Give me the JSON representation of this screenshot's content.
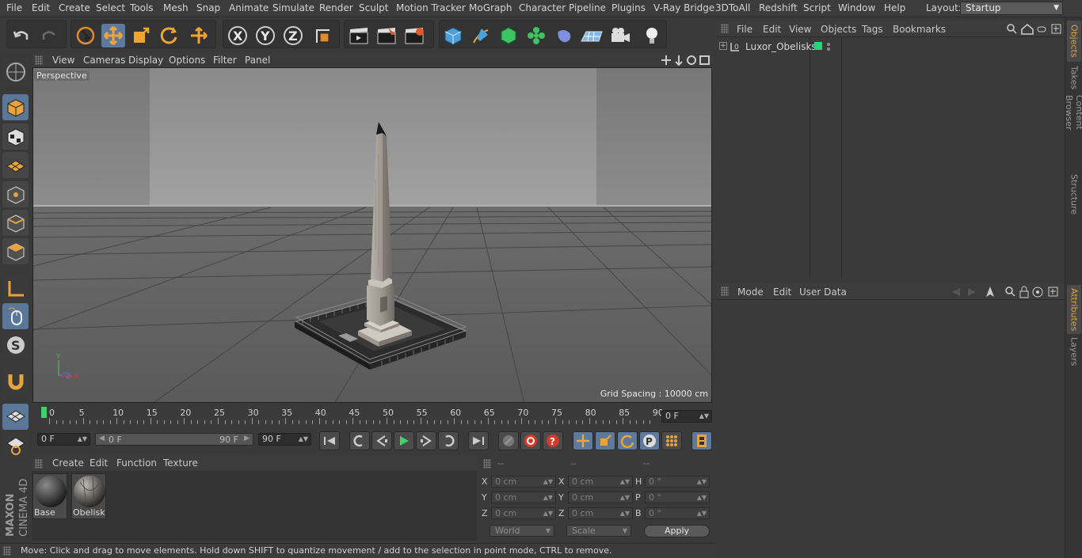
{
  "menubar": {
    "items": [
      "File",
      "Edit",
      "Create",
      "Select",
      "Tools",
      "Mesh",
      "Snap",
      "Animate",
      "Simulate",
      "Render",
      "Sculpt",
      "Motion Tracker",
      "MoGraph",
      "Character",
      "Pipeline",
      "Plugins",
      "V-Ray Bridge",
      "3DToAll",
      "Redshift",
      "Script",
      "Window",
      "Help"
    ],
    "layout_label": "Layout:",
    "layout_value": "Startup"
  },
  "viewport": {
    "menu": [
      "View",
      "Cameras",
      "Display",
      "Options",
      "Filter",
      "Panel"
    ],
    "camera_label": "Perspective",
    "grid_spacing": "Grid Spacing : 10000 cm",
    "axis_y": "Y",
    "axis_z": "Z",
    "axis_x": "X"
  },
  "timeline": {
    "ticks": [
      "0",
      "5",
      "10",
      "15",
      "20",
      "25",
      "30",
      "35",
      "40",
      "45",
      "50",
      "55",
      "60",
      "65",
      "70",
      "75",
      "80",
      "85",
      "90"
    ],
    "current_frame": "0 F"
  },
  "transport": {
    "start": "0 F",
    "range_start": "0 F",
    "range_end": "90 F",
    "end": "90 F"
  },
  "materials": {
    "menu": [
      "Create",
      "Edit",
      "Function",
      "Texture"
    ],
    "items": [
      {
        "name": "Base"
      },
      {
        "name": "Obelisk"
      }
    ]
  },
  "coords": {
    "headers": [
      "--",
      "--",
      "--"
    ],
    "rows": [
      {
        "l1": "X",
        "v1": "0 cm",
        "l2": "X",
        "v2": "0 cm",
        "l3": "H",
        "v3": "0 °"
      },
      {
        "l1": "Y",
        "v1": "0 cm",
        "l2": "Y",
        "v2": "0 cm",
        "l3": "P",
        "v3": "0 °"
      },
      {
        "l1": "Z",
        "v1": "0 cm",
        "l2": "Z",
        "v2": "0 cm",
        "l3": "B",
        "v3": "0 °"
      }
    ],
    "mode_world": "World",
    "mode_scale": "Scale",
    "apply": "Apply"
  },
  "objects": {
    "menu": [
      "File",
      "Edit",
      "View",
      "Objects",
      "Tags",
      "Bookmarks"
    ],
    "tree": [
      {
        "name": "Luxor_Obelisks"
      }
    ]
  },
  "attributes": {
    "menu": [
      "Mode",
      "Edit",
      "User Data"
    ]
  },
  "right_tabs": [
    "Objects",
    "Takes",
    "Content Browser",
    "Structure",
    "Attributes",
    "Layers"
  ],
  "brand": {
    "line1": "MAXON",
    "line2": "CINEMA 4D"
  },
  "status": "Move: Click and drag to move elements. Hold down SHIFT to quantize movement / add to the selection in point mode, CTRL to remove.",
  "colors": {
    "accent_selected": "#5d7a9e",
    "play_green": "#3fd26b",
    "record_red": "#d23a2a",
    "object_tag_green": "#2fd07a"
  }
}
